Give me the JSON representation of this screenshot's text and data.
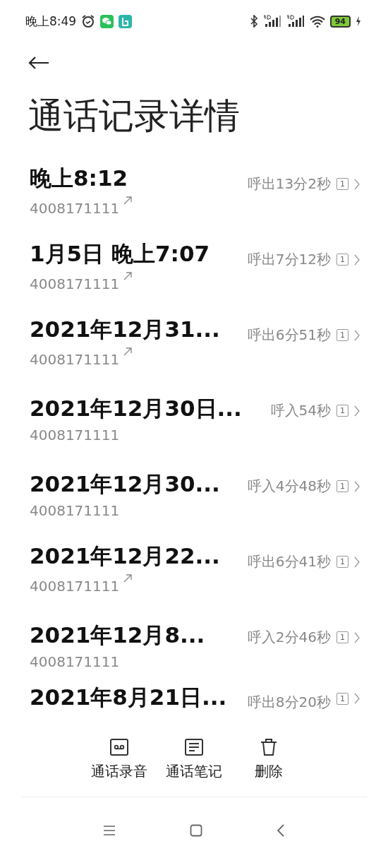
{
  "status_bar": {
    "time": "晚上8:49",
    "battery": "94"
  },
  "title": "通话记录详情",
  "calls": [
    {
      "time": "晚上8:12",
      "number": "4008171111",
      "outgoing": true,
      "duration": "呼出13分2秒",
      "sim": "1"
    },
    {
      "time": "1月5日 晚上7:07",
      "number": "4008171111",
      "outgoing": true,
      "duration": "呼出7分12秒",
      "sim": "1"
    },
    {
      "time": "2021年12月31...",
      "number": "4008171111",
      "outgoing": true,
      "duration": "呼出6分51秒",
      "sim": "1"
    },
    {
      "time": "2021年12月30日...",
      "number": "4008171111",
      "outgoing": false,
      "duration": "呼入54秒",
      "sim": "1"
    },
    {
      "time": "2021年12月30...",
      "number": "4008171111",
      "outgoing": false,
      "duration": "呼入4分48秒",
      "sim": "1"
    },
    {
      "time": "2021年12月22...",
      "number": "4008171111",
      "outgoing": true,
      "duration": "呼出6分41秒",
      "sim": "1"
    },
    {
      "time": "2021年12月8...",
      "number": "4008171111",
      "outgoing": false,
      "duration": "呼入2分46秒",
      "sim": "1"
    },
    {
      "time": "2021年8月21日...",
      "duration": "呼出8分20秒",
      "sim": "1"
    }
  ],
  "actions": [
    {
      "kind": "recording",
      "label": "通话录音"
    },
    {
      "kind": "notes",
      "label": "通话笔记"
    },
    {
      "kind": "delete",
      "label": "删除"
    }
  ]
}
